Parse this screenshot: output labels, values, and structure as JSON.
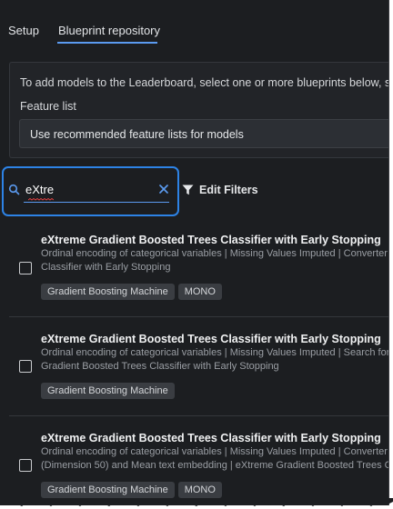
{
  "tabs": [
    {
      "label": "Setup"
    },
    {
      "label": "Blueprint repository"
    }
  ],
  "info": {
    "text": "To add models to the Leaderboard, select one or more blueprints below, s",
    "feature_list_label": "Feature list",
    "feature_list_value": "Use recommended feature lists for models"
  },
  "search": {
    "value": "eXtre",
    "placeholder": ""
  },
  "edit_filters_label": "Edit Filters",
  "blueprints": [
    {
      "title": "eXtreme Gradient Boosted Trees Classifier with Early Stopping",
      "desc_line1": "Ordinal encoding of categorical variables | Missing Values Imputed | Converter fo",
      "desc_line2": "Classifier with Early Stopping",
      "tags": [
        "Gradient Boosting Machine",
        "MONO"
      ]
    },
    {
      "title": "eXtreme Gradient Boosted Trees Classifier with Early Stopping",
      "desc_line1": "Ordinal encoding of categorical variables | Missing Values Imputed | Search for d",
      "desc_line2": "Gradient Boosted Trees Classifier with Early Stopping",
      "tags": [
        "Gradient Boosting Machine"
      ]
    },
    {
      "title": "eXtreme Gradient Boosted Trees Classifier with Early Stopping",
      "desc_line1": "Ordinal encoding of categorical variables | Missing Values Imputed | Converter fo",
      "desc_line2": "(Dimension 50) and Mean text embedding | eXtreme Gradient Boosted Trees Clas",
      "tags": [
        "Gradient Boosting Machine",
        "MONO"
      ]
    }
  ],
  "colors": {
    "background": "#1c1e21",
    "accent": "#2d83e6",
    "tab_underline": "#5b9bf0",
    "tag_bg": "#3a3d42"
  },
  "icons": [
    "search-icon",
    "close-icon",
    "filter-icon",
    "checkbox-icon"
  ]
}
